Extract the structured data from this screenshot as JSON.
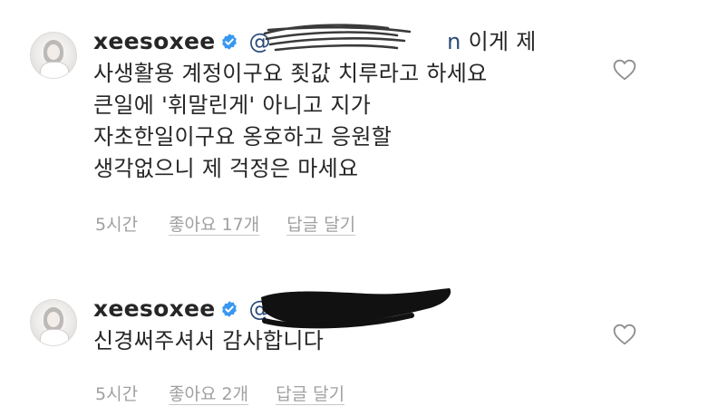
{
  "comments": [
    {
      "username": "xeesoxee",
      "mention": "@",
      "mention_tail": "n",
      "lines": [
        "이게 제",
        "사생활용 계정이구요 죗값 치루라고 하세요",
        "큰일에 '휘말린게' 아니고 지가",
        "자초한일이구요 옹호하고 응원할",
        "생각없으니 제 걱정은 마세요"
      ],
      "time": "5시간",
      "likes": "좋아요 17개",
      "reply": "답글 달기"
    },
    {
      "username": "xeesoxee",
      "mention": "@",
      "lines": [
        "신경써주셔서 감사합니다"
      ],
      "time": "5시간",
      "likes": "좋아요 2개",
      "reply": "답글 달기"
    }
  ],
  "icons": {
    "verified": "verified-badge-icon",
    "like": "heart-outline-icon"
  },
  "colors": {
    "text": "#262626",
    "meta": "#a0a0a0",
    "verified": "#3897f0",
    "mention": "#2a4a78"
  }
}
